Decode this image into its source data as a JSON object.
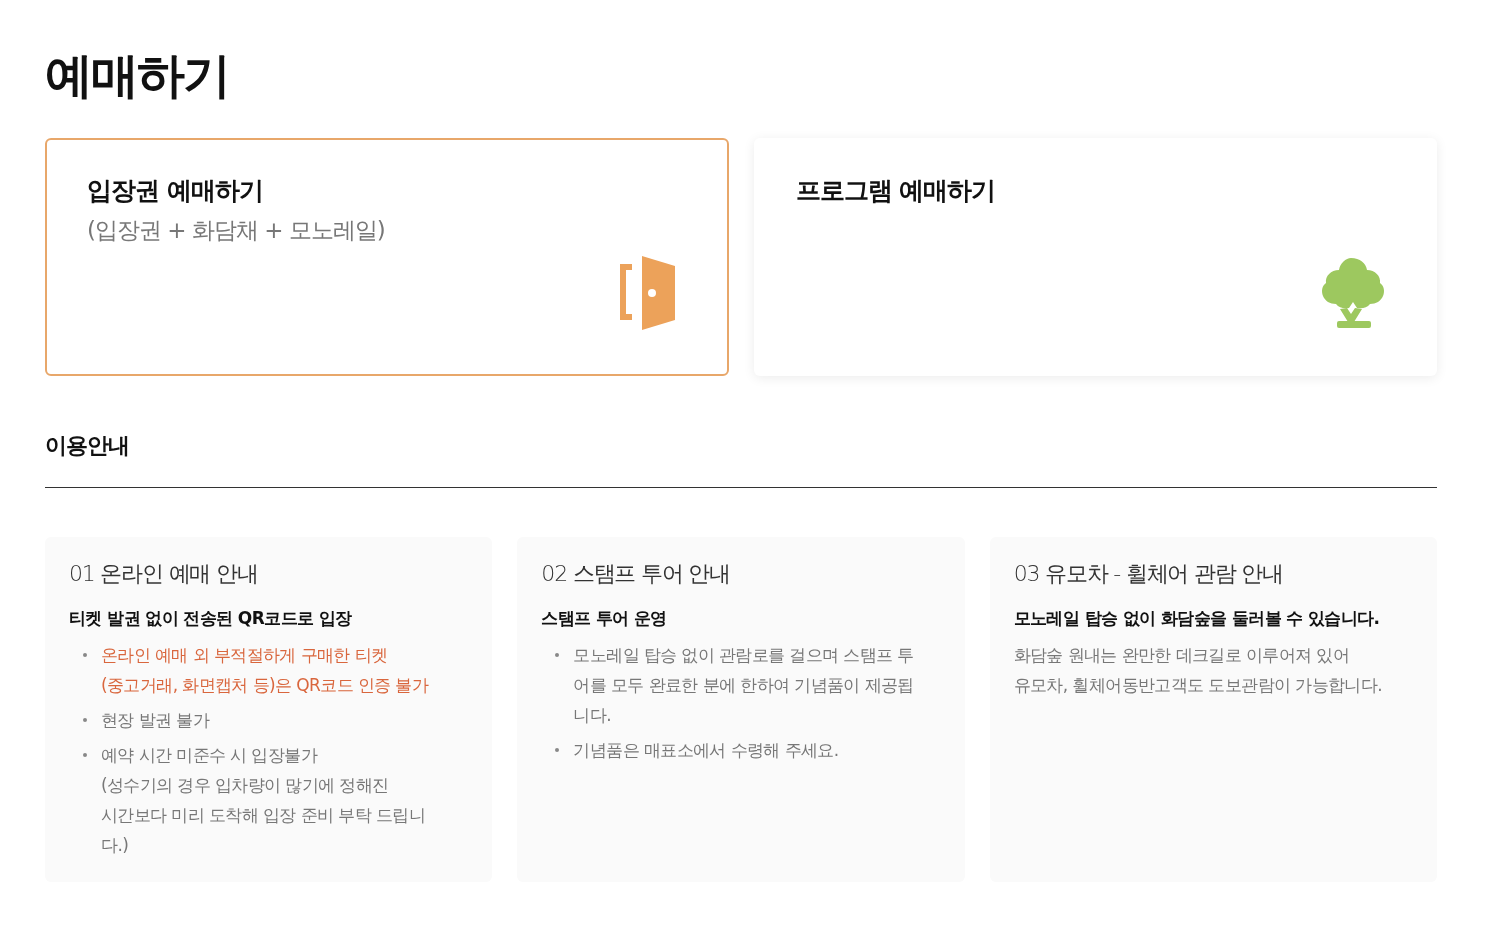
{
  "page_title": "예매하기",
  "booking_options": [
    {
      "title": "입장권 예매하기",
      "subtitle": "(입장권 + 화담채 + 모노레일)",
      "kind": "ticket",
      "selected": true
    },
    {
      "title": "프로그램 예매하기",
      "kind": "program",
      "selected": false
    }
  ],
  "info_section": {
    "title": "이용안내",
    "cards": [
      {
        "heading": "01 온라인 예매 안내",
        "subheading": "티켓 발권 없이 전송된 QR코드로 입장",
        "kind": "bullets",
        "items": [
          {
            "lines": [
              "온라인 예매 외 부적절하게 구매한 티켓",
              "(중고거래, 화면캡처 등)은 QR코드 인증 불가"
            ],
            "highlight": true
          },
          {
            "lines": [
              "현장 발권 불가"
            ],
            "highlight": false
          },
          {
            "lines": [
              "예약 시간 미준수 시 입장불가",
              "(성수기의 경우 입차량이 많기에 정해진",
              "시간보다 미리 도착해 입장 준비 부탁 드립니",
              "다.)"
            ],
            "highlight": false
          }
        ]
      },
      {
        "heading": "02 스탬프 투어 안내",
        "subheading": "스탬프 투어 운영",
        "kind": "bullets",
        "items": [
          {
            "lines": [
              "모노레일 탑승 없이 관람로를 걸으며 스탬프 투",
              "어를 모두 완료한 분에 한하여 기념품이 제공됩",
              "니다."
            ],
            "highlight": false
          },
          {
            "lines": [
              "기념품은 매표소에서 수령해 주세요."
            ],
            "highlight": false
          }
        ]
      },
      {
        "heading": "03 유모차 - 휠체어 관람 안내",
        "subheading": "모노레일 탑승 없이 화담숲을 둘러볼 수 있습니다.",
        "kind": "text",
        "lines": [
          "화담숲 원내는 완만한 데크길로 이루어져 있어",
          "유모차, 휠체어동반고객도 도보관람이 가능합니다."
        ]
      }
    ]
  }
}
